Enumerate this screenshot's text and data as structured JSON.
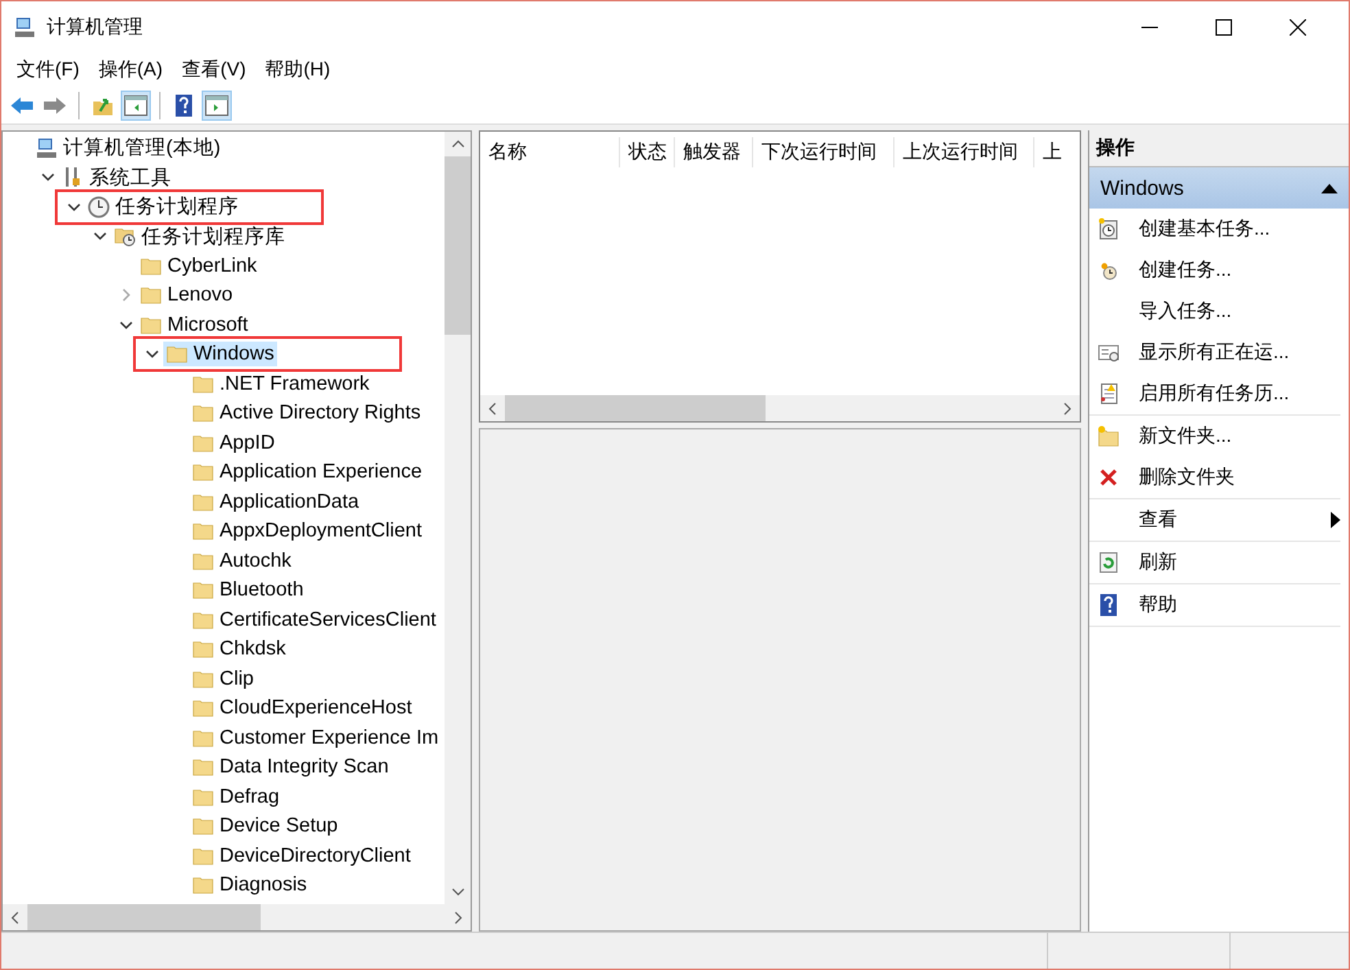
{
  "window": {
    "title": "计算机管理"
  },
  "menu": [
    "文件(F)",
    "操作(A)",
    "查看(V)",
    "帮助(H)"
  ],
  "toolbar_groups": [
    [
      {
        "kind": "back",
        "pressed": false
      },
      {
        "kind": "forward",
        "pressed": false
      }
    ],
    [
      {
        "kind": "up",
        "pressed": false
      },
      {
        "kind": "tree-toggle",
        "pressed": true
      }
    ],
    [
      {
        "kind": "help",
        "pressed": false
      },
      {
        "kind": "action-toggle",
        "pressed": true
      }
    ]
  ],
  "tree": [
    {
      "label": "计算机管理(本地)",
      "kind": "computer",
      "selected": false,
      "highlighted": false,
      "children": [
        {
          "label": "系统工具",
          "kind": "tools",
          "expanded": true,
          "selected": false,
          "highlighted": false,
          "children": [
            {
              "label": "任务计划程序",
              "kind": "scheduler",
              "expanded": true,
              "selected": false,
              "highlighted": true,
              "children": [
                {
                  "label": "任务计划程序库",
                  "kind": "library",
                  "expanded": true,
                  "selected": false,
                  "highlighted": false,
                  "children": [
                    {
                      "label": "CyberLink",
                      "kind": "folder",
                      "selected": false,
                      "highlighted": false
                    },
                    {
                      "label": "Lenovo",
                      "kind": "folder",
                      "expanded": false,
                      "selected": false,
                      "highlighted": false
                    },
                    {
                      "label": "Microsoft",
                      "kind": "folder",
                      "expanded": true,
                      "selected": false,
                      "highlighted": false,
                      "children": [
                        {
                          "label": "Windows",
                          "kind": "folder",
                          "expanded": true,
                          "selected": true,
                          "highlighted": true,
                          "children": [
                            {
                              "label": ".NET Framework",
                              "kind": "folder",
                              "selected": false,
                              "highlighted": false
                            },
                            {
                              "label": "Active Directory Rights",
                              "kind": "folder",
                              "selected": false,
                              "highlighted": false
                            },
                            {
                              "label": "AppID",
                              "kind": "folder",
                              "selected": false,
                              "highlighted": false
                            },
                            {
                              "label": "Application Experience",
                              "kind": "folder",
                              "selected": false,
                              "highlighted": false
                            },
                            {
                              "label": "ApplicationData",
                              "kind": "folder",
                              "selected": false,
                              "highlighted": false
                            },
                            {
                              "label": "AppxDeploymentClient",
                              "kind": "folder",
                              "selected": false,
                              "highlighted": false
                            },
                            {
                              "label": "Autochk",
                              "kind": "folder",
                              "selected": false,
                              "highlighted": false
                            },
                            {
                              "label": "Bluetooth",
                              "kind": "folder",
                              "selected": false,
                              "highlighted": false
                            },
                            {
                              "label": "CertificateServicesClient",
                              "kind": "folder",
                              "selected": false,
                              "highlighted": false
                            },
                            {
                              "label": "Chkdsk",
                              "kind": "folder",
                              "selected": false,
                              "highlighted": false
                            },
                            {
                              "label": "Clip",
                              "kind": "folder",
                              "selected": false,
                              "highlighted": false
                            },
                            {
                              "label": "CloudExperienceHost",
                              "kind": "folder",
                              "selected": false,
                              "highlighted": false
                            },
                            {
                              "label": "Customer Experience Im",
                              "kind": "folder",
                              "selected": false,
                              "highlighted": false
                            },
                            {
                              "label": "Data Integrity Scan",
                              "kind": "folder",
                              "selected": false,
                              "highlighted": false
                            },
                            {
                              "label": "Defrag",
                              "kind": "folder",
                              "selected": false,
                              "highlighted": false
                            },
                            {
                              "label": "Device Setup",
                              "kind": "folder",
                              "selected": false,
                              "highlighted": false
                            },
                            {
                              "label": "DeviceDirectoryClient",
                              "kind": "folder",
                              "selected": false,
                              "highlighted": false
                            },
                            {
                              "label": "Diagnosis",
                              "kind": "folder",
                              "selected": false,
                              "highlighted": false
                            }
                          ]
                        }
                      ]
                    }
                  ]
                }
              ]
            }
          ]
        }
      ]
    }
  ],
  "task_list": {
    "columns": [
      "名称",
      "状态",
      "触发器",
      "下次运行时间",
      "上次运行时间",
      "上"
    ]
  },
  "actions": {
    "title": "操作",
    "section": {
      "label": "Windows",
      "expanded": true
    },
    "groups": [
      [
        {
          "label": "创建基本任务...",
          "kind": "basic-task",
          "submenu": false
        },
        {
          "label": "创建任务...",
          "kind": "task",
          "submenu": false
        },
        {
          "label": "导入任务...",
          "kind": "import",
          "submenu": false
        },
        {
          "label": "显示所有正在运...",
          "kind": "running",
          "submenu": false
        },
        {
          "label": "启用所有任务历...",
          "kind": "history",
          "submenu": false
        }
      ],
      [
        {
          "label": "新文件夹...",
          "kind": "new-folder",
          "submenu": false
        },
        {
          "label": "删除文件夹",
          "kind": "delete",
          "submenu": false
        }
      ],
      [
        {
          "label": "查看",
          "kind": "view",
          "submenu": true
        }
      ],
      [
        {
          "label": "刷新",
          "kind": "refresh",
          "submenu": false
        }
      ],
      [
        {
          "label": "帮助",
          "kind": "help",
          "submenu": false
        }
      ]
    ]
  }
}
